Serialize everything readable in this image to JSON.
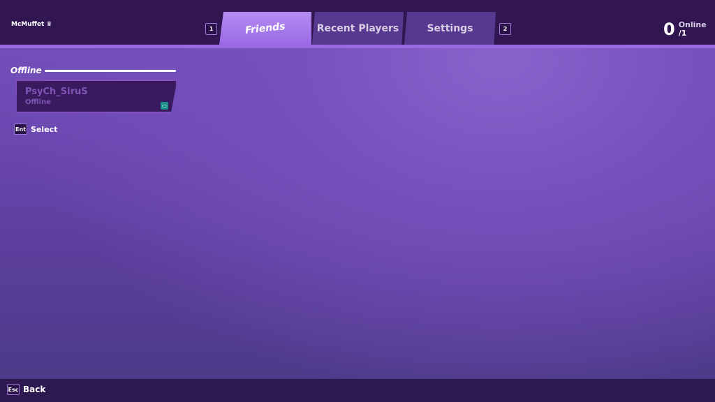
{
  "header": {
    "username": "McMuffet",
    "user_badge_icon": "crown-icon",
    "tabs": [
      {
        "label": "Friends",
        "active": true
      },
      {
        "label": "Recent Players",
        "active": false
      },
      {
        "label": "Settings",
        "active": false
      }
    ],
    "prev_tab_key": "1",
    "next_tab_key": "2",
    "online": {
      "count": "0",
      "label": "Online",
      "total": "/1"
    }
  },
  "friends": {
    "section_title": "Offline",
    "items": [
      {
        "name": "PsyCh_SiruS",
        "status": "Offline",
        "platform_icon": "pc-icon"
      }
    ]
  },
  "hints": {
    "select_key": "Ent",
    "select_label": "Select",
    "back_key": "Esc",
    "back_label": "Back"
  },
  "colors": {
    "header": "#311652",
    "accent": "#9a6ae4",
    "active_tab": "#b48cf2",
    "platform": "#1e8d8a"
  }
}
